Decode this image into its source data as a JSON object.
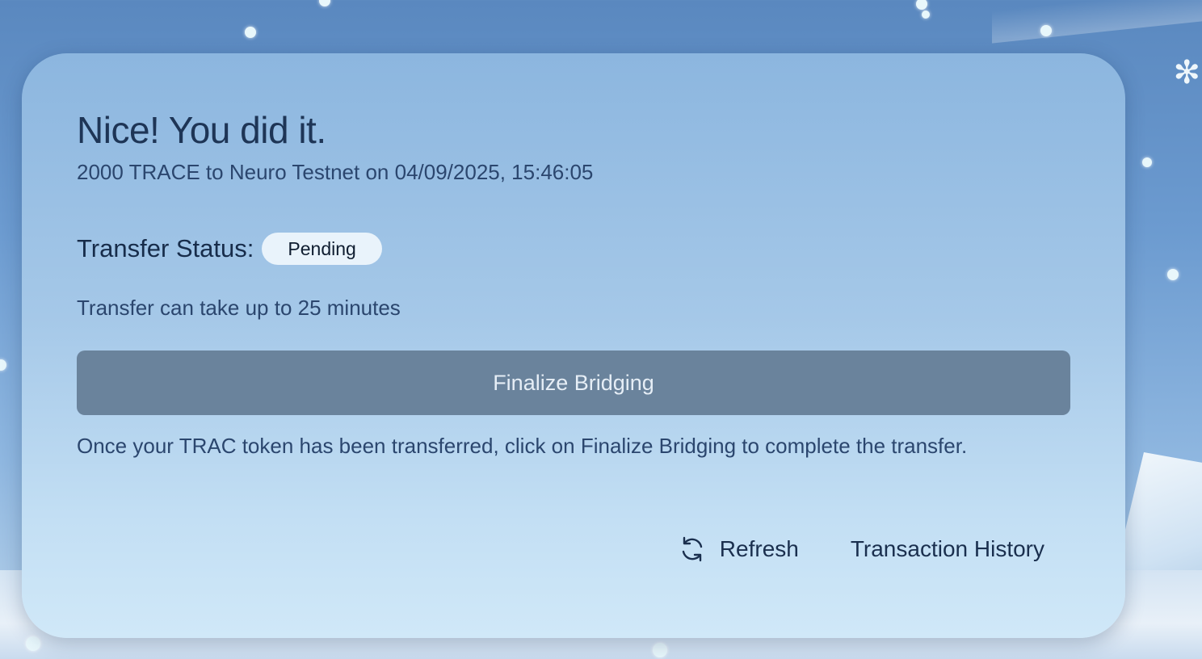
{
  "dialog": {
    "title": "Nice! You did it.",
    "subtitle": "2000 TRACE to Neuro Testnet on 04/09/2025, 15:46:05",
    "status_label": "Transfer Status:",
    "status_value": "Pending",
    "eta_text": "Transfer can take up to 25 minutes",
    "finalize_label": "Finalize Bridging",
    "hint_text": "Once your TRAC token has been transferred, click on Finalize Bridging to complete the transfer.",
    "refresh_label": "Refresh",
    "refresh_icon": "refresh-icon",
    "history_label": "Transaction History"
  },
  "colors": {
    "card_top": "#8cb6df",
    "card_bottom": "#d0e8f8",
    "button_bg": "#6a839c",
    "badge_bg": "#e9f3fb",
    "text_dark": "#1e3556"
  }
}
